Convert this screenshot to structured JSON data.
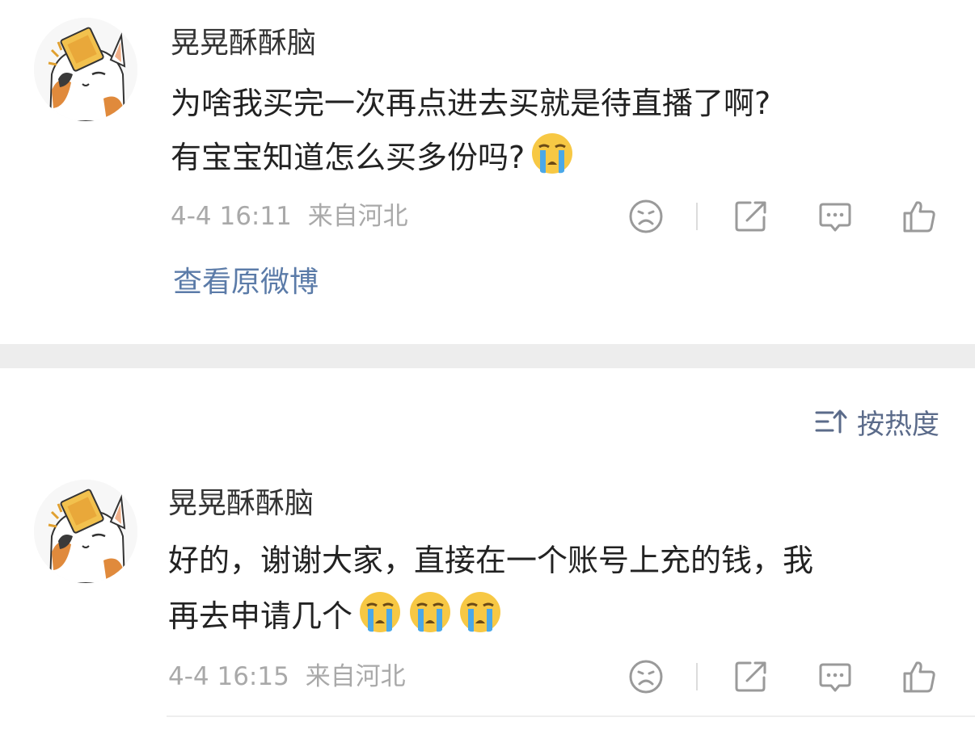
{
  "posts": [
    {
      "username": "晃晃酥酥脑",
      "text_lines": [
        "为啥我买完一次再点进去买就是待直播了啊?",
        "有宝宝知道怎么买多份吗?"
      ],
      "emoji": "crying-face",
      "time": "4-4 16:11",
      "location": "来自河北",
      "view_original": "查看原微博"
    }
  ],
  "sort": {
    "label": "按热度",
    "icon": "sort-icon"
  },
  "comments": [
    {
      "username": "晃晃酥酥脑",
      "text_lines": [
        "好的，谢谢大家，直接在一个账号上充的钱，我",
        "再去申请几个"
      ],
      "emoji": "crying-face",
      "emoji_count": 3,
      "time": "4-4 16:15",
      "location": "来自河北"
    }
  ],
  "actions": [
    "dislike-icon",
    "share-icon",
    "comment-icon",
    "like-icon"
  ],
  "colors": {
    "link": "#5b7ba8",
    "meta": "#a9a9a9",
    "band": "#ededed",
    "emoji": "#f7c844",
    "tears": "#4aa8e8"
  }
}
